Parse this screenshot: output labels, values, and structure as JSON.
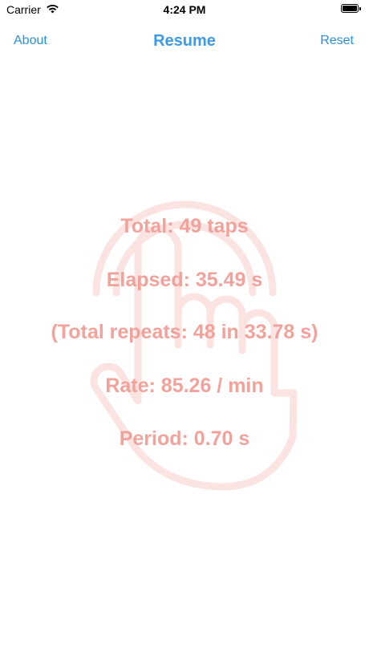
{
  "status_bar": {
    "carrier": "Carrier",
    "time": "4:24 PM",
    "wifi_icon": "wifi-icon",
    "battery_icon": "battery-icon",
    "battery_level": 1.0
  },
  "nav": {
    "left_label": "About",
    "title": "Resume",
    "right_label": "Reset"
  },
  "background_icon": "tap-hand-icon",
  "stats": {
    "total": "Total: 49 taps",
    "elapsed": "Elapsed: 35.49 s",
    "repeats": "(Total repeats: 48 in 33.78 s)",
    "rate": "Rate: 85.26 / min",
    "period": "Period: 0.70 s"
  },
  "colors": {
    "accent": "#3b9be6",
    "link": "#2a8fdc",
    "stat_text": "#f2a29a",
    "hand_outline": "#fbe3e1"
  }
}
